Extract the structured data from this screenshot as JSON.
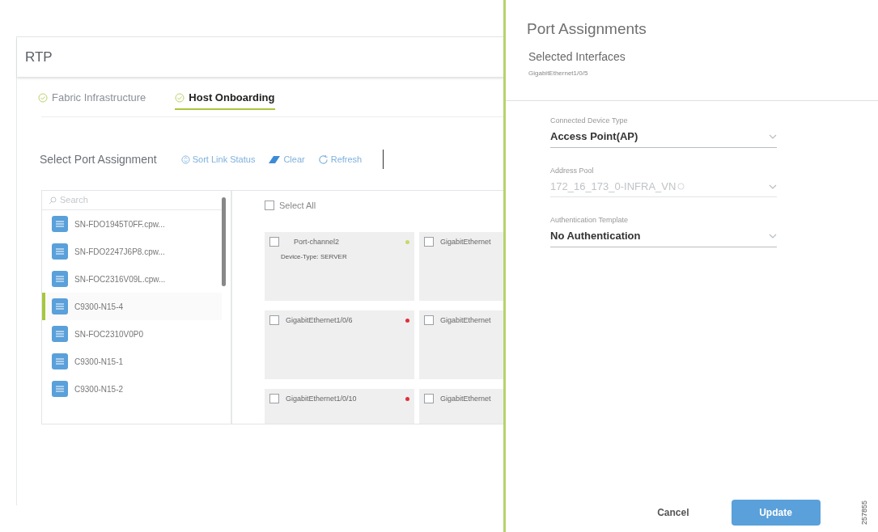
{
  "page": {
    "title": "RTP"
  },
  "tabs": [
    {
      "label": "Fabric Infrastructure",
      "selected": false
    },
    {
      "label": "Host Onboarding",
      "selected": true
    }
  ],
  "toolbar": {
    "title": "Select Port Assignment",
    "actions": [
      {
        "kind": "sort",
        "label": "Sort Link Status"
      },
      {
        "kind": "clear",
        "label": "Clear"
      },
      {
        "kind": "refresh",
        "label": "Refresh"
      }
    ]
  },
  "device_list": {
    "search": {
      "placeholder": "Search"
    },
    "items": [
      {
        "name": "SN-FDO1945T0FF.cpw...",
        "selected": false
      },
      {
        "name": "SN-FDO2247J6P8.cpw...",
        "selected": false
      },
      {
        "name": "SN-FOC2316V09L.cpw...",
        "selected": false
      },
      {
        "name": "C9300-N15-4",
        "selected": true
      },
      {
        "name": "SN-FOC2310V0P0",
        "selected": false
      },
      {
        "name": "C9300-N15-1",
        "selected": false
      },
      {
        "name": "C9300-N15-2",
        "selected": false
      }
    ]
  },
  "ports": {
    "select_all": {
      "label": "Select All",
      "checked": false
    },
    "cards": [
      {
        "name": "Port-channel2",
        "detail": "Device-Type: SERVER",
        "checked": false,
        "color": "#c8d86a"
      },
      {
        "name": "GigabitEthernet",
        "checked": false
      },
      {
        "name": "GigabitEthernet1/0/6",
        "checked": false,
        "color": "#e0303a"
      },
      {
        "name": "GigabitEthernet",
        "checked": false
      },
      {
        "name": "GigabitEthernet1/0/10",
        "checked": false,
        "color": "#e0303a"
      },
      {
        "name": "GigabitEthernet",
        "checked": false
      }
    ]
  },
  "drawer": {
    "title": "Port Assignments",
    "selected_label": "Selected Interfaces",
    "selected_value": "GigabitEthernet1/0/5",
    "fields": [
      {
        "label": "Connected Device Type",
        "value": "Access Point(AP)",
        "disabled": false,
        "info": false
      },
      {
        "label": "Address Pool",
        "value": "172_16_173_0-INFRA_VN",
        "disabled": true,
        "info": true
      },
      {
        "label": "Authentication Template",
        "value": "No Authentication",
        "disabled": false,
        "info": false
      }
    ],
    "buttons": [
      {
        "kind": "secondary",
        "label": "Cancel"
      },
      {
        "kind": "primary",
        "label": "Update"
      }
    ]
  },
  "figure_number": "257855"
}
